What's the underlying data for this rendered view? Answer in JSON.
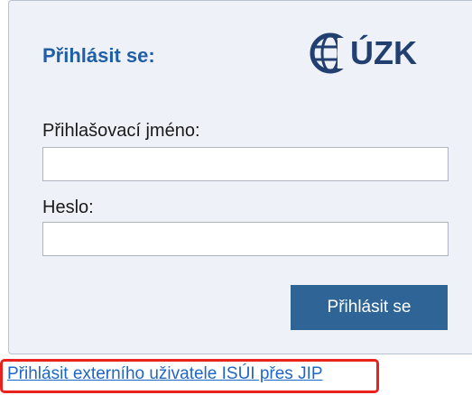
{
  "login": {
    "title": "Přihlásit se:",
    "logo_text": "ÚZK",
    "username_label": "Přihlašovací jméno:",
    "username_value": "",
    "password_label": "Heslo:",
    "password_value": "",
    "submit_label": "Přihlásit se"
  },
  "external_link": {
    "label": "Přihlásit externího uživatele ISÚI přes JIP"
  },
  "icons": {
    "logo": "cuzk-globe-logo-icon"
  },
  "colors": {
    "title": "#1f5fa8",
    "button": "#2f6596",
    "link": "#1e66c8",
    "highlight": "#e8221c",
    "panel": "#eef1f7"
  }
}
